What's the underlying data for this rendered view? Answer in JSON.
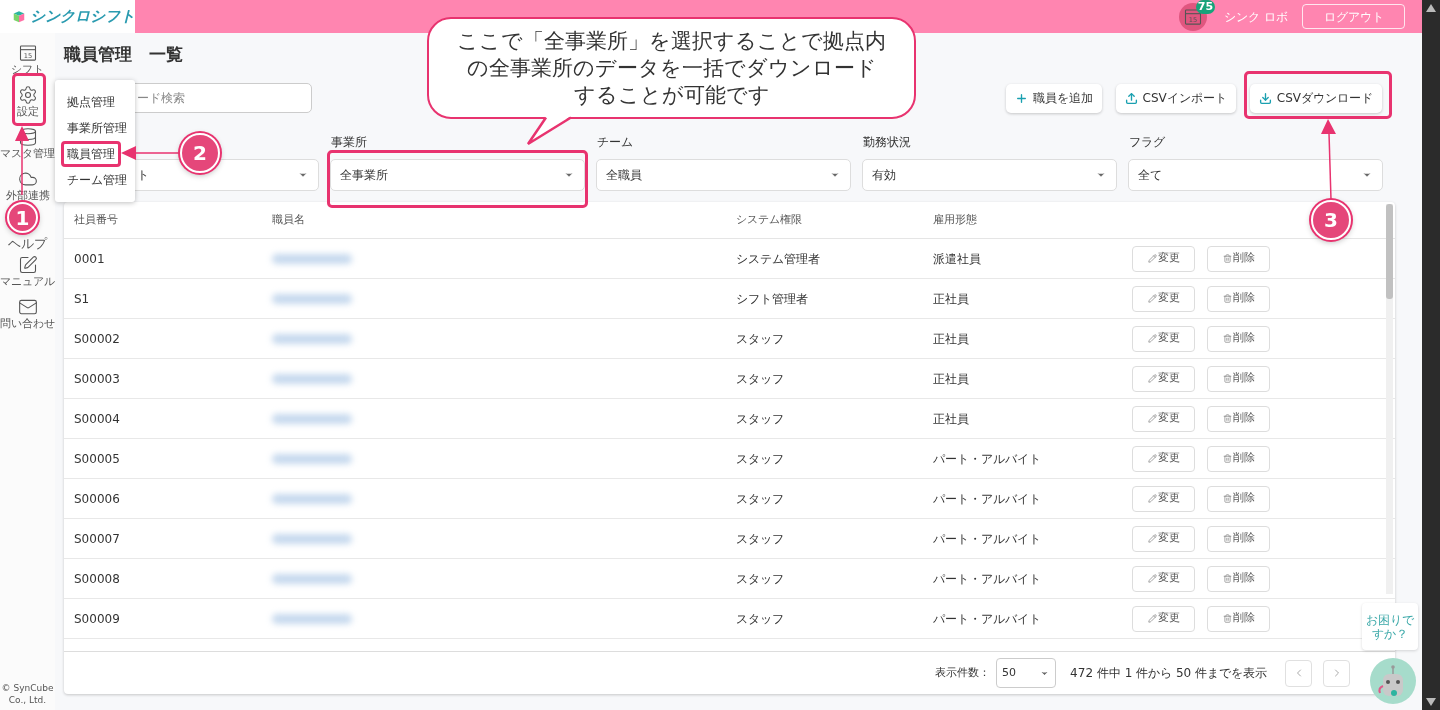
{
  "header": {
    "logo": "シンクロシフト",
    "calendar_day": "15",
    "badge": "75",
    "user": "シンク ロボ",
    "logout": "ログアウト"
  },
  "sidebar": {
    "calendar_day": "15",
    "items": [
      {
        "label": "シフト"
      },
      {
        "label": "設定"
      },
      {
        "label": "マスタ管理"
      },
      {
        "label": "外部連携"
      },
      {
        "label": "ヘルプ"
      },
      {
        "label": "マニュアル"
      },
      {
        "label": "問い合わせ"
      }
    ],
    "copyright": "© SynCube Co., Ltd."
  },
  "menu": {
    "items": [
      {
        "label": "拠点管理",
        "highlighted": false
      },
      {
        "label": "事業所管理",
        "highlighted": false
      },
      {
        "label": "職員管理",
        "highlighted": true
      },
      {
        "label": "チーム管理",
        "highlighted": false
      }
    ]
  },
  "page": {
    "title": "職員管理　一覧",
    "search_placeholder": "ード検索",
    "buttons": [
      "職員を追加",
      "CSVインポート",
      "CSVダウンロード"
    ]
  },
  "filters": [
    {
      "value": "ト"
    },
    {
      "label": "事業所",
      "value": "全事業所"
    },
    {
      "label": "チーム",
      "value": "全職員"
    },
    {
      "label": "勤務状況",
      "value": "有効"
    },
    {
      "label": "フラグ",
      "value": "全て"
    }
  ],
  "table": {
    "columns": [
      "社員番号",
      "職員名",
      "システム権限",
      "雇用形態"
    ],
    "rows": [
      {
        "id": "0001",
        "role": "システム管理者",
        "employment": "派遣社員",
        "edit": "変更",
        "delete": "削除"
      },
      {
        "id": "S1",
        "role": "シフト管理者",
        "employment": "正社員",
        "edit": "変更",
        "delete": "削除"
      },
      {
        "id": "S00002",
        "role": "スタッフ",
        "employment": "正社員",
        "edit": "変更",
        "delete": "削除"
      },
      {
        "id": "S00003",
        "role": "スタッフ",
        "employment": "正社員",
        "edit": "変更",
        "delete": "削除"
      },
      {
        "id": "S00004",
        "role": "スタッフ",
        "employment": "正社員",
        "edit": "変更",
        "delete": "削除"
      },
      {
        "id": "S00005",
        "role": "スタッフ",
        "employment": "パート・アルバイト",
        "edit": "変更",
        "delete": "削除"
      },
      {
        "id": "S00006",
        "role": "スタッフ",
        "employment": "パート・アルバイト",
        "edit": "変更",
        "delete": "削除"
      },
      {
        "id": "S00007",
        "role": "スタッフ",
        "employment": "パート・アルバイト",
        "edit": "変更",
        "delete": "削除"
      },
      {
        "id": "S00008",
        "role": "スタッフ",
        "employment": "パート・アルバイト",
        "edit": "変更",
        "delete": "削除"
      },
      {
        "id": "S00009",
        "role": "スタッフ",
        "employment": "パート・アルバイト",
        "edit": "変更",
        "delete": "削除"
      }
    ]
  },
  "footer": {
    "per_page_label": "表示件数：",
    "per_page": "50",
    "summary": "472 件中 1 件から 50 件までを表示"
  },
  "help": {
    "lines": [
      "お困りで",
      "すか？"
    ]
  },
  "annotations": {
    "callout": [
      "ここで「全事業所」を選択することで拠点内",
      "の全事業所のデータを一括でダウンロード",
      "することが可能です"
    ],
    "markers": [
      "1",
      "2",
      "3"
    ]
  }
}
